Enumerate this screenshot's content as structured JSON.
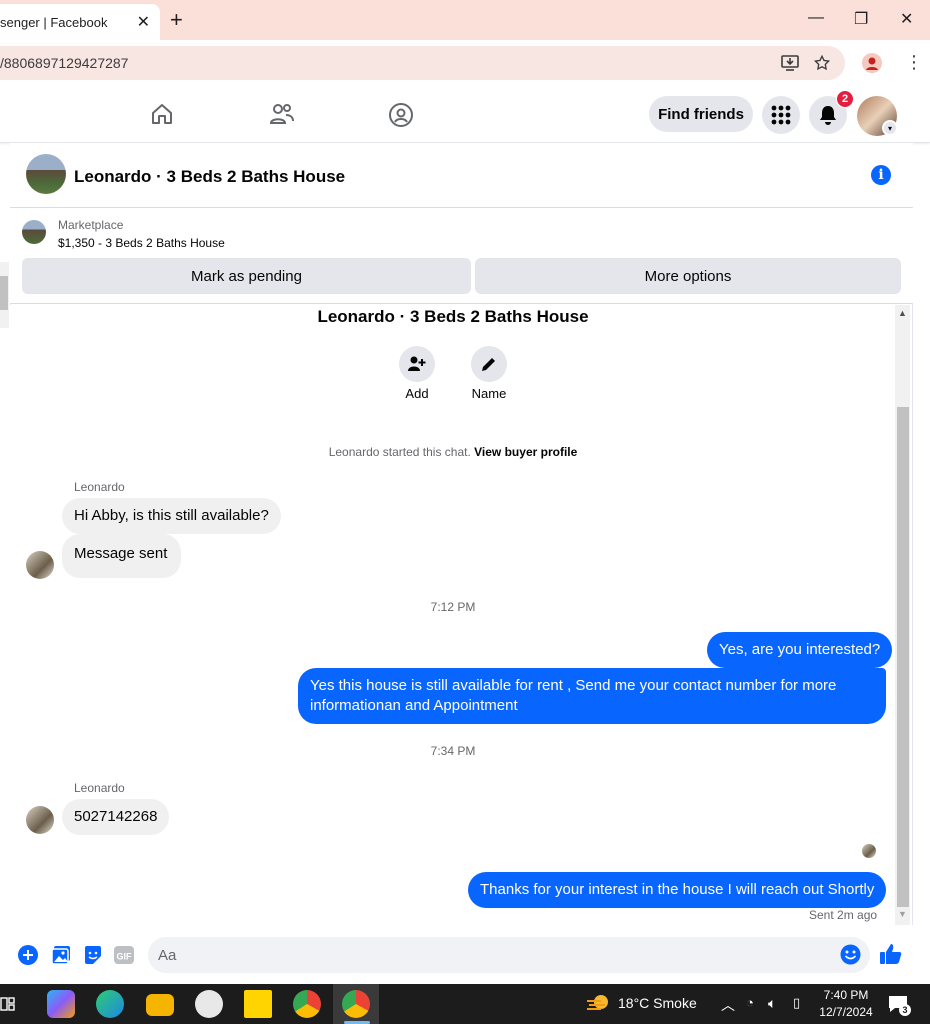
{
  "browser": {
    "tab_title": "senger | Facebook",
    "url": "/8806897129427287"
  },
  "fbnav": {
    "find_friends": "Find friends",
    "notifications_count": "2"
  },
  "thread": {
    "title": "Leonardo · 3 Beds 2 Baths House",
    "listing_category": "Marketplace",
    "listing_name": "$1,350 - 3 Beds 2 Baths House",
    "mark_pending": "Mark as pending",
    "more_options": "More options",
    "center_title": "Leonardo · 3 Beds 2 Baths House",
    "add_label": "Add",
    "name_label": "Name",
    "started_text": "Leonardo started this chat.",
    "view_buyer_profile": "View buyer profile"
  },
  "messages": {
    "sender_1": "Leonardo",
    "in_1": "Hi Abby, is this still available?",
    "in_2": "Message sent",
    "time_1": "7:12 PM",
    "out_1": "Yes, are you interested?",
    "out_2": "Yes this house is still available for rent , Send me your contact number for more informationan and Appointment",
    "time_2": "7:34 PM",
    "sender_2": "Leonardo",
    "in_3": "5027142268",
    "out_3": "Thanks for your interest in the house I will reach out Shortly",
    "sent_status": "Sent 2m ago"
  },
  "composer": {
    "placeholder": "Aa"
  },
  "taskbar": {
    "weather": "18°C  Smoke",
    "time": "7:40 PM",
    "date": "12/7/2024",
    "notif_count": "3"
  },
  "colors": {
    "accent": "#0866ff",
    "bubble_in": "#f0f0f0",
    "badge": "#e41e3f"
  }
}
